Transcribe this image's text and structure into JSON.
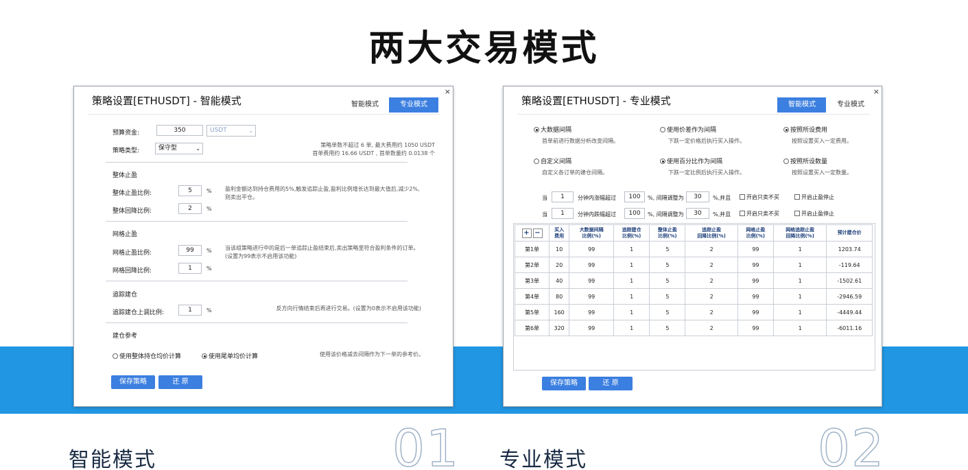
{
  "headline": "两大交易模式",
  "smart": {
    "title": "策略设置[ETHUSDT] - 智能模式",
    "tab_smart": "智能模式",
    "tab_pro": "专业模式",
    "close": "×",
    "budget_label": "预算资金:",
    "budget_value": "350",
    "currency": "USDT",
    "type_label": "策略类型:",
    "type_value": "保守型",
    "summary_1": "策略单数不超过 6 单, 最大费用约 1050 USDT",
    "summary_2": "首单费用约 16.66 USDT , 首单数量约 0.0138 个",
    "overall_tp_title": "整体止盈",
    "overall_tp_ratio_label": "整体止盈比例:",
    "overall_tp_ratio": "5",
    "overall_tp_retrace_label": "整体回降比例:",
    "overall_tp_retrace": "2",
    "overall_tp_hint": "盈利金额达到持仓费用的5%,触发追踪止盈,盈利比例增长达到最大值后,减少2%,则卖出平仓。",
    "grid_tp_title": "网格止盈",
    "grid_tp_ratio_label": "网格止盈比例:",
    "grid_tp_ratio": "99",
    "grid_tp_retrace_label": "网格回降比例:",
    "grid_tp_retrace": "1",
    "grid_tp_hint": "当该组策略进行中的是后一单追踪止盈结束后,卖出策略里符合盈利条件的订单。(设置为99表示不启用该功能)",
    "trail_title": "追踪建仓",
    "trail_label": "追踪建仓上调比例:",
    "trail_value": "1",
    "trail_hint": "反方向行情结束后再进行交易。(设置为0表示不启用该功能)",
    "ref_title": "建仓参考",
    "ref_opt1": "使用整体持仓均价计算",
    "ref_opt2": "使用尾单均价计算",
    "ref_hint": "使用该价格减去间隔作为下一单的参考价。",
    "save": "保存策略",
    "restore": "还 原",
    "unit": "%"
  },
  "pro": {
    "title": "策略设置[ETHUSDT] - 专业模式",
    "tab_smart": "智能模式",
    "tab_pro": "专业模式",
    "close": "×",
    "opt_a1": "大数据间隔",
    "opt_a1_hint": "首单前进行数据分析改变间隔。",
    "opt_a2": "使用价差作为间隔",
    "opt_a2_hint": "下跌一定价格后执行买入操作。",
    "opt_a3": "按照所设费用",
    "opt_a3_hint": "按照设置买入一定费用。",
    "opt_b1": "自定义间隔",
    "opt_b1_hint": "自定义各订单的建仓间隔。",
    "opt_b2": "使用百分比作为间隔",
    "opt_b2_hint": "下跌一定比例后执行买入操作。",
    "opt_b3": "按照所设数量",
    "opt_b3_hint": "按照设置买入一定数量。",
    "rule_when": "当",
    "rule1_min": "1",
    "rule1_mid": "分钟内涨幅超过",
    "rule1_pct": "100",
    "rule1_adj": "%, 间隔调整为",
    "rule1_val": "30",
    "rule2_min": "1",
    "rule2_mid": "分钟内跌幅超过",
    "rule2_pct": "100",
    "rule2_adj": "%, 间隔调整为",
    "rule2_val": "30",
    "rule_and": "%,并且",
    "chk_buy": "开启只卖不买",
    "chk_stop": "开启止盈停止",
    "plus": "+",
    "minus": "−",
    "columns": [
      "买入\n费用",
      "大数据间隔\n比例(%)",
      "追踪建仓\n比例(%)",
      "整体止盈\n比例(%)",
      "追踪止盈\n回降比例(%)",
      "网格止盈\n比例(%)",
      "网格追踪止盈\n回降比例(%)",
      "预计建仓价"
    ],
    "rows": [
      {
        "name": "第1单",
        "cells": [
          "10",
          "99",
          "1",
          "5",
          "2",
          "99",
          "1",
          "1203.74"
        ]
      },
      {
        "name": "第2单",
        "cells": [
          "20",
          "99",
          "1",
          "5",
          "2",
          "99",
          "1",
          "-119.64"
        ]
      },
      {
        "name": "第3单",
        "cells": [
          "40",
          "99",
          "1",
          "5",
          "2",
          "99",
          "1",
          "-1502.61"
        ]
      },
      {
        "name": "第4单",
        "cells": [
          "80",
          "99",
          "1",
          "5",
          "2",
          "99",
          "1",
          "-2946.59"
        ]
      },
      {
        "name": "第5单",
        "cells": [
          "160",
          "99",
          "1",
          "5",
          "2",
          "99",
          "1",
          "-4449.44"
        ]
      },
      {
        "name": "第6单",
        "cells": [
          "320",
          "99",
          "1",
          "5",
          "2",
          "99",
          "1",
          "-6011.16"
        ]
      }
    ],
    "save": "保存策略",
    "restore": "还 原"
  },
  "captions": {
    "smart": "智能模式",
    "smart_num": "01",
    "pro": "专业模式",
    "pro_num": "02"
  },
  "colors": {
    "accent": "#3b7fe0",
    "band": "#2196e3"
  }
}
